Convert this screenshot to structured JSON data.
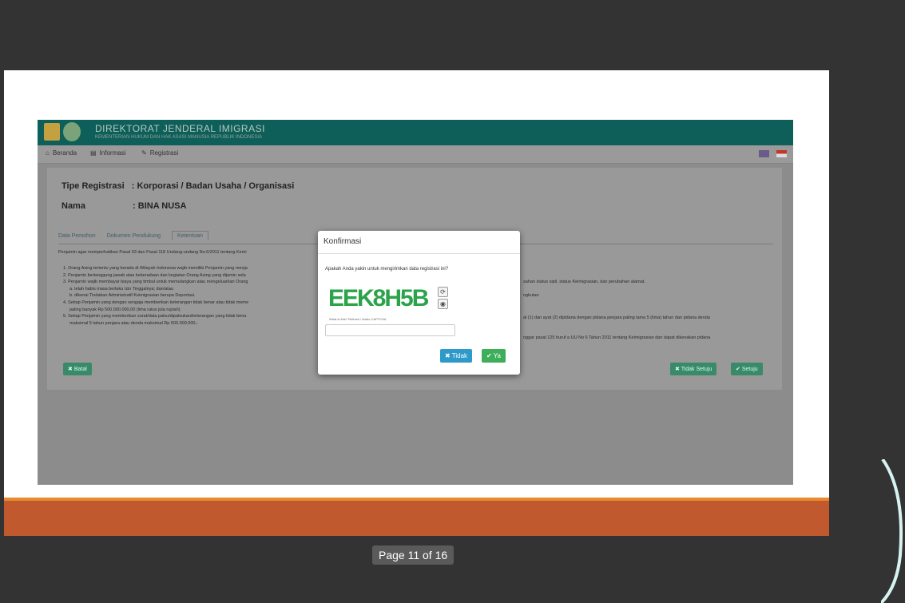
{
  "app": {
    "title": "DIREKTORAT JENDERAL IMIGRASI",
    "subtitle": "KEMENTERIAN HUKUM DAN HAK ASASI MANUSIA REPUBLIK INDONESIA",
    "nav": [
      {
        "icon": "home-icon",
        "label": "Beranda"
      },
      {
        "icon": "book-icon",
        "label": "Informasi"
      },
      {
        "icon": "pencil-icon",
        "label": "Registrasi"
      }
    ]
  },
  "registration": {
    "type_label": "Tipe Registrasi",
    "type_value": ": Korporasi / Badan Usaha / Organisasi",
    "name_label": "Nama",
    "name_value": ": BINA NUSA"
  },
  "tabs": [
    "Data Pemohon",
    "Dokumen Pendukung",
    "Ketentuan"
  ],
  "terms": {
    "intro": "Penjamin agar memperhatikan Pasal 63 dan Pasal 118 Undang-undang No.6/2011 tentang Kemi",
    "items": [
      "1. Orang Asing tertentu yang berada di Wilayah Indonesia wajib memiliki Penjamin yang menja",
      "2. Penjamin bertanggung jawab atas keberadaan dan kegiatan Orang Asing yang dijamin sela",
      "3. Penjamin wajib membayar biaya yang timbul untuk memulangkan atau mengeluarkan Orang",
      "   a. telah habis masa berlaku Izin Tinggalnya; dan/atau",
      "   b. dikenai Tindakan Administratif Keimigrasian berupa Deportasi.",
      "4. Setiap Penjamin yang dengan sengaja memberikan keterangan tidak benar atau tidak meme",
      "   paling banyak Rp 500.000.000,00 (lima ratus juta rupiah).",
      "5. Setiap Penjamin yang memberikan surat/data palsu/dipalsukan/keterangan yang tidak bena",
      "   maksimal 5 tahun penjara atau denda maksimal Rp 500.000.000,-"
    ],
    "right_fragments": [
      "sahan status sipil, status Keimigrasian, dan perubahan alamat.",
      "ngkutan",
      "al (1) dan ayat (2) dipidana dengan pidana penjara paling lama 5 (lima) tahun dan pidana denda",
      "nggar pasal 125 huruf a UU No 6 Tahun 2011 tentang Keimigrasian dan dapat dikenakan pidana"
    ]
  },
  "buttons": {
    "back": "Batal",
    "disagree": "Tidak Setuju",
    "agree": "Setuju"
  },
  "modal": {
    "title": "Konfirmasi",
    "question": "Apakah Anda yakin untuk mengirimkan data registrasi ini?",
    "captcha_text": "EEK8H5B",
    "captcha_note": "What is this? Refresh / Audio CAPTCHA",
    "input_value": "",
    "no_label": "Tidak",
    "yes_label": "Ya"
  },
  "viewer": {
    "page_indicator": "Page 11 of 16"
  },
  "colors": {
    "header": "#0e5e5a",
    "orange_band": "#c0592e",
    "btn_no": "#2d9ac9",
    "btn_yes": "#3fae5a",
    "captcha": "#2aa34a"
  }
}
